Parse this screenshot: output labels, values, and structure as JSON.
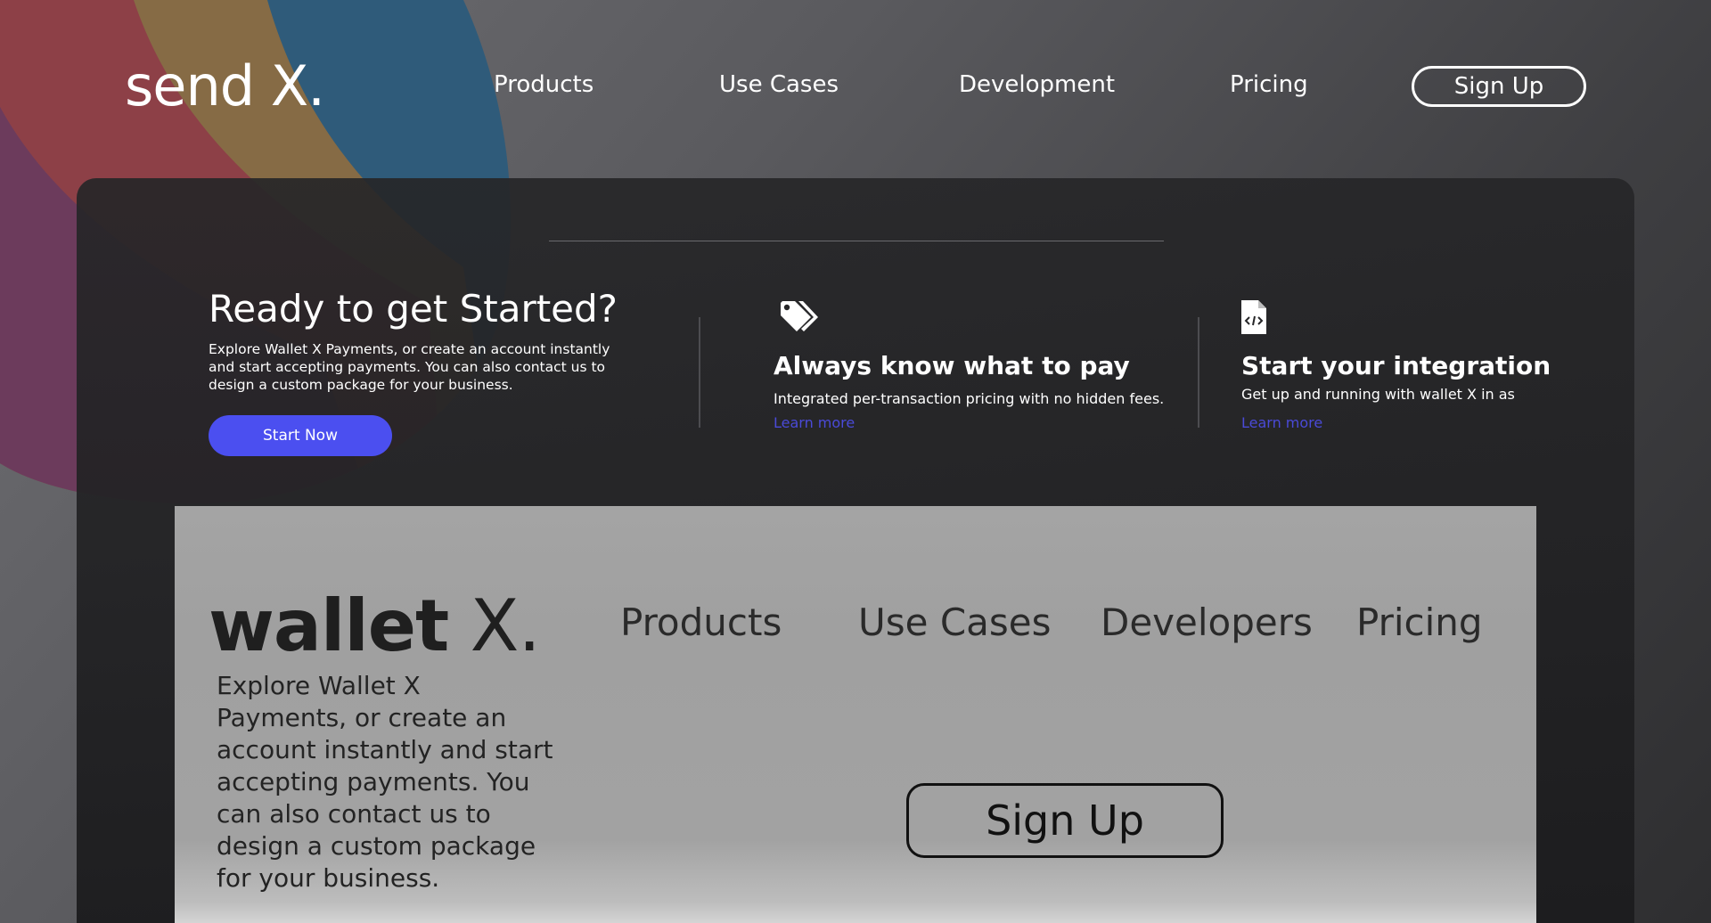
{
  "colors": {
    "accent": "#4b4ff0",
    "learn_more": "#4a4ad8",
    "blob_blue": "#2f5b7a",
    "blob_orange": "#8b6d42",
    "blob_red": "#8d3e48",
    "blob_purple": "#6a3b5e"
  },
  "header": {
    "brand": "send X.",
    "nav": [
      "Products",
      "Use Cases",
      "Development",
      "Pricing"
    ],
    "signup_label": "Sign Up"
  },
  "cta": {
    "title": "Ready to get Started?",
    "body": "Explore Wallet X Payments, or create an account instantly and start accepting payments. You can also contact us to design a custom package for your business.",
    "button_label": "Start Now"
  },
  "features": [
    {
      "icon": "price-tag-icon",
      "title": "Always know what to pay",
      "body": "Integrated per-transaction pricing with no hidden fees.",
      "link": "Learn more"
    },
    {
      "icon": "code-file-icon",
      "title": "Start your integration",
      "body": "Get up and running with wallet X in as",
      "link": "Learn more"
    }
  ],
  "preview": {
    "brand_bold": "wallet",
    "brand_light": " X.",
    "nav": [
      "Products",
      "Use Cases",
      "Developers",
      "Pricing"
    ],
    "body": "Explore Wallet X Payments, or create an account instantly and start accepting payments. You can also contact us to design a custom package for your business.",
    "signup_label": "Sign Up"
  }
}
